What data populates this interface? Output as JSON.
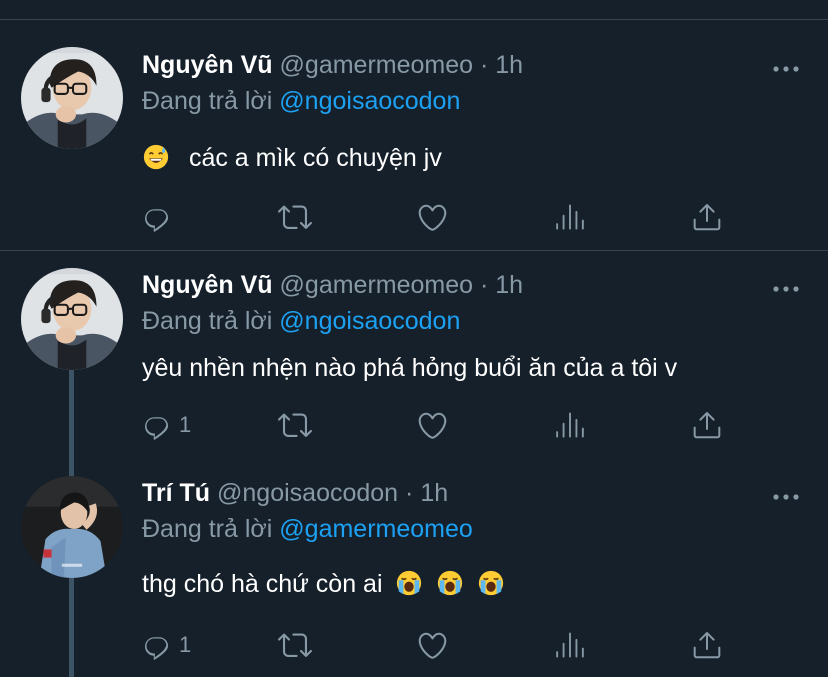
{
  "colors": {
    "background": "#15202b",
    "divider": "#38444d",
    "secondary_text": "#8899a6",
    "mention": "#1da1f2",
    "thread_line": "#3d5466"
  },
  "tweets": [
    {
      "name": "Nguyên Vũ",
      "handle": "@gamermeomeo",
      "dot": "·",
      "time": "1h",
      "reply_prefix": "Đang trả lời",
      "reply_to": "@ngoisaocodon",
      "text": "các a mìk có chuyện jv",
      "leading_emoji": "grinning-sweat-emoji",
      "reply_count": "",
      "avatar": "avatar-nguyen-vu"
    },
    {
      "name": "Nguyên Vũ",
      "handle": "@gamermeomeo",
      "dot": "·",
      "time": "1h",
      "reply_prefix": "Đang trả lời",
      "reply_to": "@ngoisaocodon",
      "text": "yêu nhền nhện nào phá hỏng buổi ăn của a tôi v",
      "reply_count": "1",
      "avatar": "avatar-nguyen-vu"
    },
    {
      "name": "Trí Tú",
      "handle": "@ngoisaocodon",
      "dot": "·",
      "time": "1h",
      "reply_prefix": "Đang trả lời",
      "reply_to": "@gamermeomeo",
      "text": "thg chó hà chứ còn ai",
      "trailing_emojis": [
        "loudly-crying-emoji",
        "loudly-crying-emoji",
        "loudly-crying-emoji"
      ],
      "reply_count": "1",
      "avatar": "avatar-tri-tu"
    }
  ],
  "action_icons": [
    "reply-icon",
    "retweet-icon",
    "like-icon",
    "analytics-icon",
    "share-icon"
  ]
}
